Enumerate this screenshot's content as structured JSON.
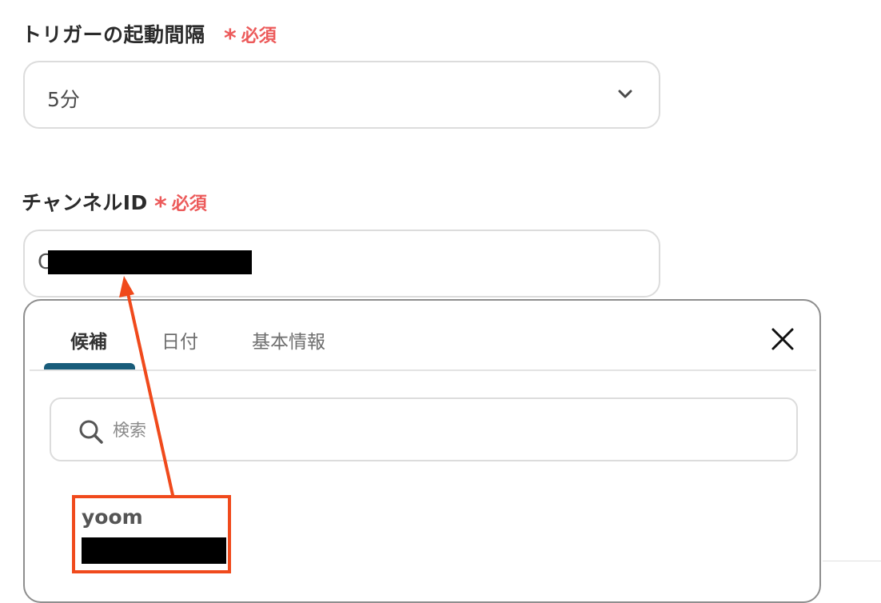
{
  "trigger_interval": {
    "label": "トリガーの起動間隔",
    "required_mark": "*",
    "required_text": "必須",
    "selected_value": "5分",
    "chevron_icon": "chevron-down-icon"
  },
  "channel_id": {
    "label": "チャンネルID",
    "required_mark": "*",
    "required_text": "必須",
    "value_prefix": "C"
  },
  "dropdown": {
    "tabs": [
      {
        "label": "候補",
        "active": true
      },
      {
        "label": "日付",
        "active": false
      },
      {
        "label": "基本情報",
        "active": false
      }
    ],
    "close_icon": "close-icon",
    "search": {
      "placeholder": "検索",
      "icon": "search-icon"
    },
    "candidates": [
      {
        "name": "yoom"
      }
    ]
  },
  "annotation": {
    "color": "#f04a1c"
  },
  "colors": {
    "required": "#ec5a5a",
    "active_tab_underline": "#185c7a",
    "border": "#dcdcdc"
  }
}
